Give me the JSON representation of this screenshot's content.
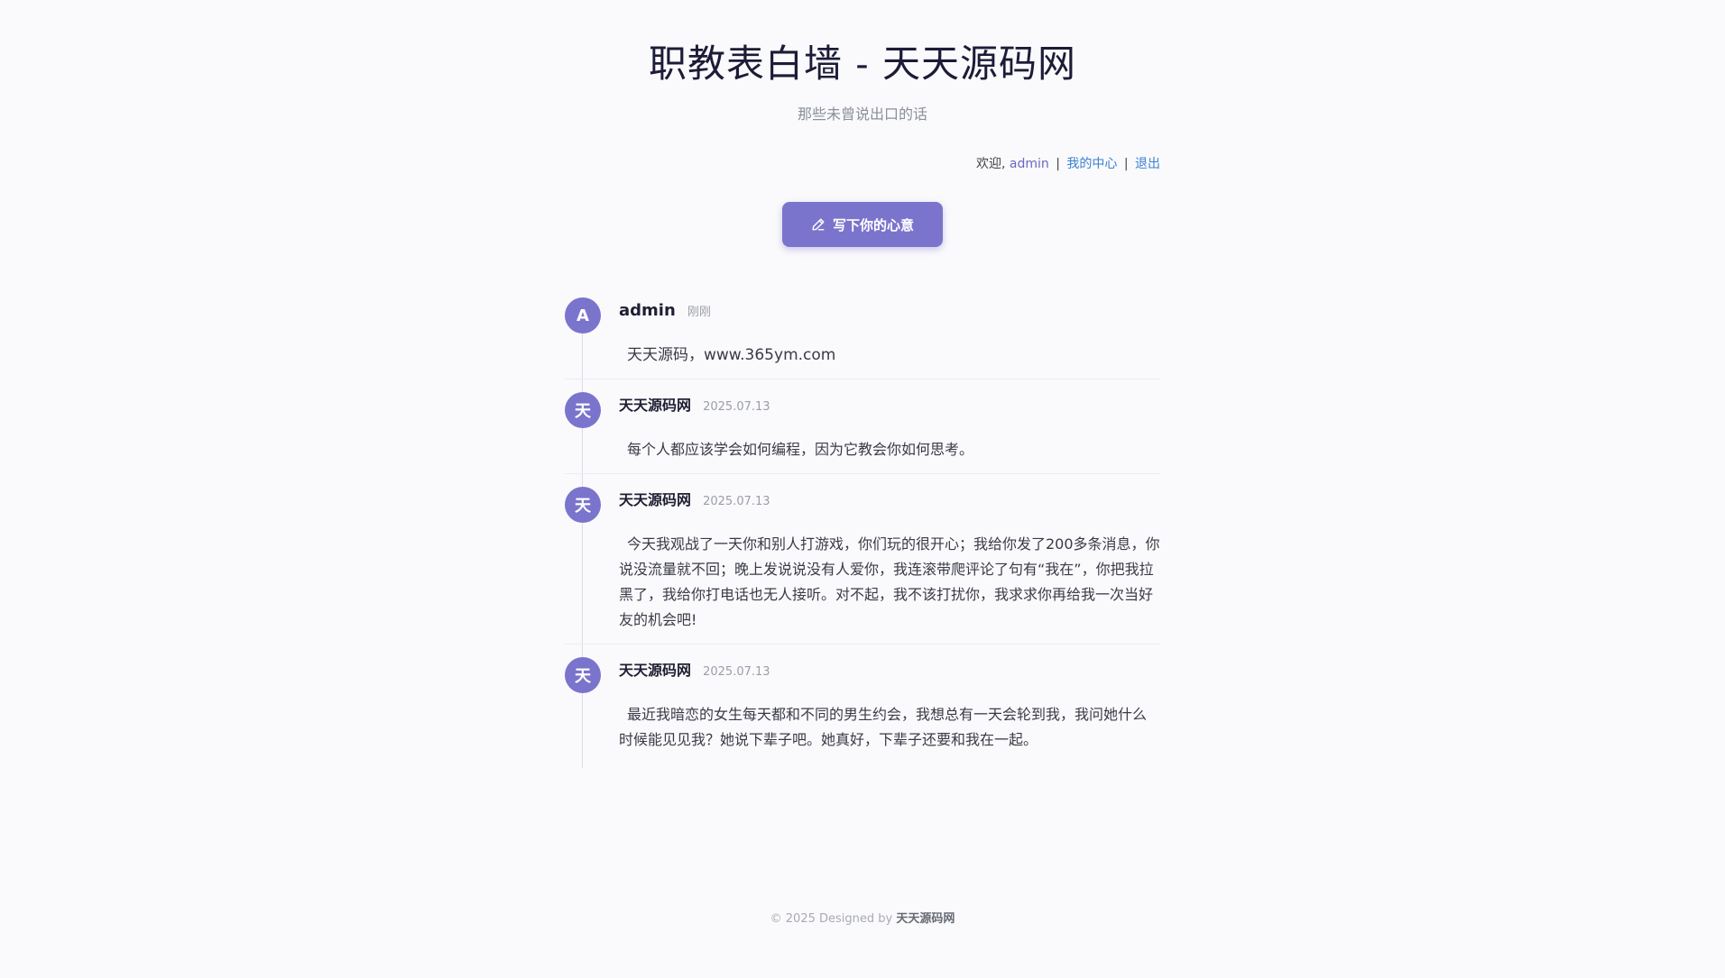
{
  "header": {
    "title": "职教表白墙 - 天天源码网",
    "subtitle": "那些未曾说出口的话"
  },
  "userbar": {
    "welcome": "欢迎,",
    "username": "admin",
    "separator": "|",
    "center_link": "我的中心",
    "logout_link": "退出"
  },
  "write_button": {
    "icon": "pencil-icon",
    "label": "写下你的心意"
  },
  "posts": [
    {
      "avatar": "A",
      "author": "admin",
      "time": "刚刚",
      "content": "天天源码，www.365ym.com"
    },
    {
      "avatar": "天",
      "author": "天天源码网",
      "time": "2025.07.13",
      "content": "每个人都应该学会如何编程，因为它教会你如何思考。"
    },
    {
      "avatar": "天",
      "author": "天天源码网",
      "time": "2025.07.13",
      "content": "今天我观战了一天你和别人打游戏，你们玩的很开心；我给你发了200多条消息，你说没流量就不回；晚上发说说没有人爱你，我连滚带爬评论了句有“我在”，你把我拉黑了，我给你打电话也无人接听。对不起，我不该打扰你，我求求你再给我一次当好友的机会吧!"
    },
    {
      "avatar": "天",
      "author": "天天源码网",
      "time": "2025.07.13",
      "content": "最近我暗恋的女生每天都和不同的男生约会，我想总有一天会轮到我，我问她什么时候能见见我？她说下辈子吧。她真好，下辈子还要和我在一起。"
    }
  ],
  "footer": {
    "prefix": "© 2025 Designed by",
    "brand": "天天源码网"
  },
  "colors": {
    "accent": "#7b74cc",
    "link": "#3d7fd0",
    "background": "#fafafc"
  }
}
